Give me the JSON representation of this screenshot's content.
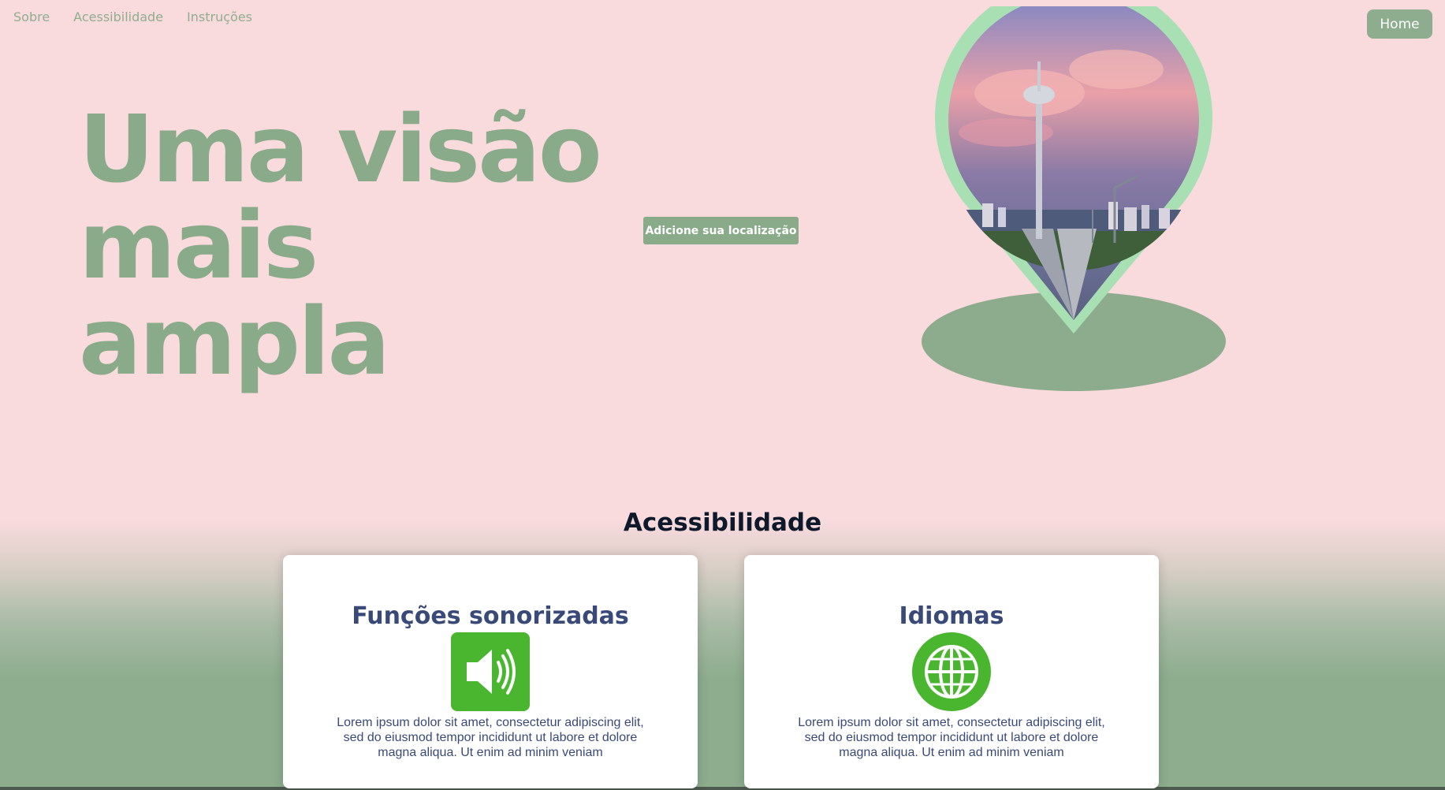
{
  "nav": {
    "items": [
      {
        "label": "Sobre"
      },
      {
        "label": "Acessibilidade"
      },
      {
        "label": "Instruções"
      }
    ],
    "home_label": "Home"
  },
  "hero": {
    "title_line1": "Uma visão",
    "title_line2": "mais ampla",
    "add_location_label": "Adicione sua localização"
  },
  "accessibility": {
    "title": "Acessibilidade",
    "cards": [
      {
        "title": "Funções sonorizadas",
        "icon": "speaker-icon",
        "text": "Lorem ipsum dolor sit amet, consectetur adipiscing elit, sed do eiusmod tempor incididunt ut labore et dolore magna aliqua. Ut enim ad minim veniam"
      },
      {
        "title": "Idiomas",
        "icon": "globe-icon",
        "text": "Lorem ipsum dolor sit amet, consectetur adipiscing elit, sed do eiusmod tempor incididunt ut labore et dolore magna aliqua. Ut enim ad minim veniam"
      }
    ]
  },
  "colors": {
    "background": "#f9dadd",
    "accent_green": "#8dad8e",
    "pin_ring": "#a8e0b4",
    "icon_green": "#4ab52f",
    "card_text": "#394a78"
  }
}
